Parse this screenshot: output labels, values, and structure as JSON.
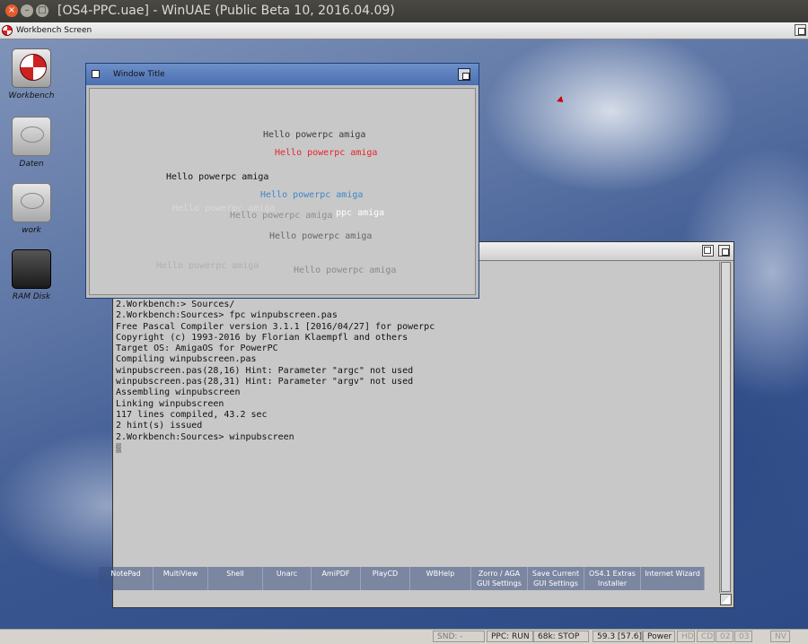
{
  "host_window": {
    "title": "[OS4-PPC.uae] - WinUAE (Public Beta 10, 2016.04.09)",
    "buttons": [
      "close",
      "minimize",
      "maximize"
    ]
  },
  "screen_bar": {
    "title": "Workbench Screen",
    "icon": "amiga-boing-ball-icon"
  },
  "desktop_icons": [
    {
      "label": "Workbench",
      "icon": "workbench-ball-icon"
    },
    {
      "label": "Daten",
      "icon": "harddisk-icon"
    },
    {
      "label": "work",
      "icon": "harddisk-icon"
    },
    {
      "label": "RAM Disk",
      "icon": "ramdisk-icon"
    }
  ],
  "front_window": {
    "title": "Window Title",
    "lines": [
      {
        "text": "Hello powerpc amiga",
        "color": "#3c3c3c"
      },
      {
        "text": "Hello powerpc amiga",
        "color": "#e8242a"
      },
      {
        "text": "Hello powerpc amiga",
        "color": "#111111"
      },
      {
        "text": "Hello powerpc amiga",
        "color": "#3f86c6"
      },
      {
        "text": "Hello powerpc amiga",
        "color": "#dadada"
      },
      {
        "text": "Hello powerpc amiga",
        "color": "#8e8e8e"
      },
      {
        "text": "ppc amiga",
        "color": "#ffffff"
      },
      {
        "text": "Hello powerpc amiga",
        "color": "#666666"
      },
      {
        "text": "Hello powerpc amiga",
        "color": "#b0b0b0"
      },
      {
        "text": "Hello powerpc amiga",
        "color": "#8a8a8a"
      }
    ]
  },
  "shell": {
    "lines": [
      "2.Workbench:> Sources/",
      "2.Workbench:Sources> fpc winpubscreen.pas",
      "Free Pascal Compiler version 3.1.1 [2016/04/27] for powerpc",
      "Copyright (c) 1993-2016 by Florian Klaempfl and others",
      "Target OS: AmigaOS for PowerPC",
      "Compiling winpubscreen.pas",
      "winpubscreen.pas(28,16) Hint: Parameter \"argc\" not used",
      "winpubscreen.pas(28,31) Hint: Parameter \"argv\" not used",
      "Assembling winpubscreen",
      "Linking winpubscreen",
      "117 lines compiled, 43.2 sec",
      "2 hint(s) issued",
      "2.Workbench:Sources> winpubscreen"
    ]
  },
  "dock": [
    {
      "label": "NotePad"
    },
    {
      "label": "MultiView"
    },
    {
      "label": "Shell"
    },
    {
      "label": "Unarc"
    },
    {
      "label": "AmiPDF"
    },
    {
      "label": "PlayCD"
    },
    {
      "label": "WBHelp"
    },
    {
      "label": "Zorro / AGA GUI Settings"
    },
    {
      "label": "Save Current GUI Settings"
    },
    {
      "label": "OS4.1 Extras Installer"
    },
    {
      "label": "Internet Wizard"
    }
  ],
  "status_bar": {
    "snd": "SND: -",
    "ppc": "PPC: RUN",
    "k68": "68k: STOP",
    "fps": "59.3 [57.6]",
    "power": "Power",
    "hd": "HD",
    "cd": "CD",
    "d02": "02",
    "d03": "03",
    "nv": "NV"
  }
}
